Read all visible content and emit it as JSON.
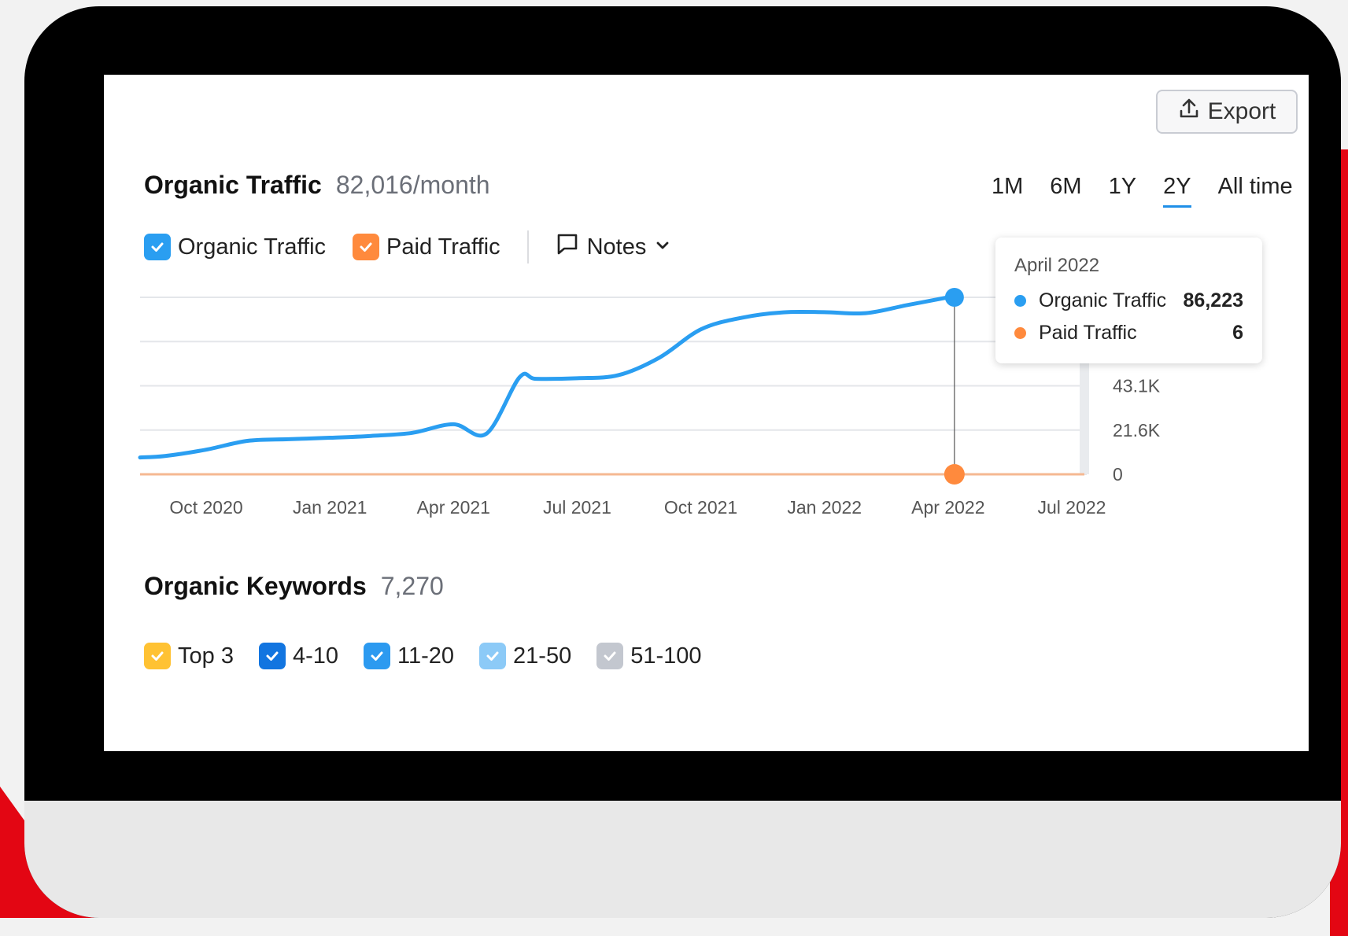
{
  "toolbar": {
    "export_label": "Export"
  },
  "traffic": {
    "title": "Organic Traffic",
    "value": "82,016/month",
    "periods": [
      "1M",
      "6M",
      "1Y",
      "2Y",
      "All time"
    ],
    "active_period": "2Y",
    "legend": [
      {
        "label": "Organic Traffic",
        "color": "#2a9ef1",
        "checked": true
      },
      {
        "label": "Paid Traffic",
        "color": "#ff8a3d",
        "checked": true
      }
    ],
    "notes_label": "Notes"
  },
  "tooltip": {
    "date": "April 2022",
    "rows": [
      {
        "name": "Organic Traffic",
        "value": "86,223",
        "color": "#2a9ef1"
      },
      {
        "name": "Paid Traffic",
        "value": "6",
        "color": "#ff8a3d"
      }
    ]
  },
  "chart_data": {
    "type": "line",
    "x_ticks": [
      "Oct 2020",
      "Jan 2021",
      "Apr 2021",
      "Jul 2021",
      "Oct 2021",
      "Jan 2022",
      "Apr 2022",
      "Jul 2022"
    ],
    "y_ticks": [
      "0",
      "21.6K",
      "43.1K"
    ],
    "ylim": [
      0,
      86223
    ],
    "grid": true,
    "series": [
      {
        "name": "Organic Traffic",
        "color": "#2a9ef1",
        "x": [
          "Aug 2020",
          "Sep 2020",
          "Oct 2020",
          "Nov 2020",
          "Dec 2020",
          "Jan 2021",
          "Feb 2021",
          "Mar 2021",
          "Apr 2021",
          "May 2021",
          "May 2021",
          "Jun 2021",
          "Jul 2021",
          "Aug 2021",
          "Sep 2021",
          "Oct 2021",
          "Nov 2021",
          "Dec 2021",
          "Jan 2022",
          "Feb 2022",
          "Mar 2022",
          "Apr 2022"
        ],
        "values": [
          8200,
          8900,
          12000,
          16300,
          17100,
          17800,
          18700,
          20200,
          24400,
          19800,
          47200,
          46500,
          46800,
          48300,
          56900,
          70600,
          76300,
          78900,
          79000,
          78500,
          82400,
          86223
        ]
      },
      {
        "name": "Paid Traffic",
        "color": "#ff8a3d",
        "x": [
          "Aug 2020",
          "Apr 2022",
          "Jul 2022"
        ],
        "values": [
          6,
          6,
          6
        ]
      }
    ]
  },
  "keywords": {
    "title": "Organic Keywords",
    "value": "7,270",
    "legend": [
      {
        "label": "Top 3",
        "color": "#ffc233"
      },
      {
        "label": "4-10",
        "color": "#1275e0"
      },
      {
        "label": "11-20",
        "color": "#2c9af0"
      },
      {
        "label": "21-50",
        "color": "#8ccaf7"
      },
      {
        "label": "51-100",
        "color": "#c3c7cf"
      }
    ]
  }
}
